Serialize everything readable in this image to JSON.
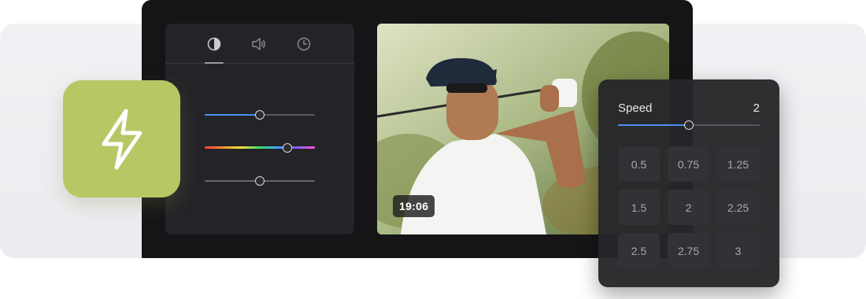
{
  "controls_panel": {
    "tabs": [
      {
        "icon": "contrast-icon",
        "active": true
      },
      {
        "icon": "volume-icon",
        "active": false
      },
      {
        "icon": "clock-icon",
        "active": false
      }
    ],
    "sliders": [
      {
        "name": "blue-slider",
        "value": 0.5
      },
      {
        "name": "hue-slider",
        "value": 0.75
      },
      {
        "name": "gray-slider",
        "value": 0.5
      }
    ]
  },
  "video": {
    "timestamp": "19:06"
  },
  "app_icon": {
    "icon": "lightning-bolt-icon",
    "color": "#b8c764"
  },
  "speed_panel": {
    "title": "Speed",
    "current": "2",
    "slider_value": 0.5,
    "options": [
      "0.5",
      "0.75",
      "1.25",
      "1.5",
      "2",
      "2.25",
      "2.5",
      "2.75",
      "3"
    ]
  },
  "colors": {
    "accent": "#4d8ef5",
    "panel": "#242428",
    "device": "#151518"
  }
}
